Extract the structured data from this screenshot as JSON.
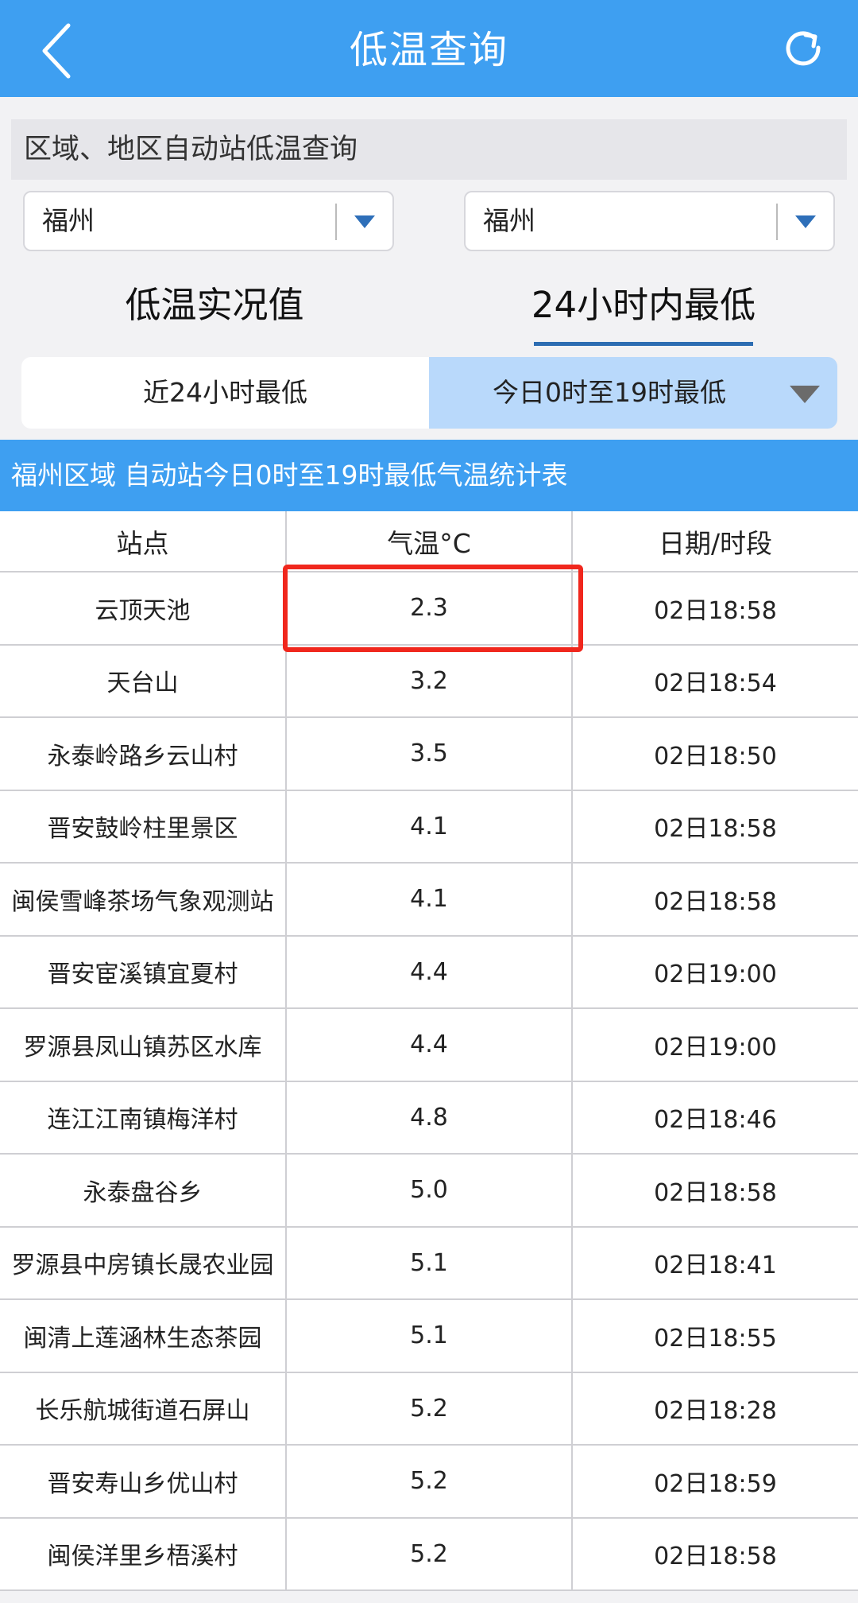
{
  "header": {
    "title": "低温查询",
    "back_icon": "chevron-left-icon",
    "refresh_icon": "refresh-icon"
  },
  "query": {
    "section_label": "区域、地区自动站低温查询",
    "region_select": "福州",
    "area_select": "福州"
  },
  "tabs": {
    "main": [
      "低温实况值",
      "24小时内最低"
    ],
    "active_main": "24小时内最低",
    "sub": [
      "近24小时最低",
      "今日0时至19时最低"
    ],
    "active_sub": "今日0时至19时最低"
  },
  "table": {
    "title": "福州区域 自动站今日0时至19时最低气温统计表",
    "columns": [
      "站点",
      "气温°C",
      "日期/时段"
    ],
    "rows": [
      [
        "云顶天池",
        "2.3",
        "02日18:58"
      ],
      [
        "天台山",
        "3.2",
        "02日18:54"
      ],
      [
        "永泰岭路乡云山村",
        "3.5",
        "02日18:50"
      ],
      [
        "晋安鼓岭柱里景区",
        "4.1",
        "02日18:58"
      ],
      [
        "闽侯雪峰茶场气象观测站",
        "4.1",
        "02日18:58"
      ],
      [
        "晋安宦溪镇宜夏村",
        "4.4",
        "02日19:00"
      ],
      [
        "罗源县凤山镇苏区水库",
        "4.4",
        "02日19:00"
      ],
      [
        "连江江南镇梅洋村",
        "4.8",
        "02日18:46"
      ],
      [
        "永泰盘谷乡",
        "5.0",
        "02日18:58"
      ],
      [
        "罗源县中房镇长晟农业园",
        "5.1",
        "02日18:41"
      ],
      [
        "闽清上莲涵林生态茶园",
        "5.1",
        "02日18:55"
      ],
      [
        "长乐航城街道石屏山",
        "5.2",
        "02日18:28"
      ],
      [
        "晋安寿山乡优山村",
        "5.2",
        "02日18:59"
      ],
      [
        "闽侯洋里乡梧溪村",
        "5.2",
        "02日18:58"
      ]
    ]
  },
  "colors": {
    "accent": "#3e9ff1",
    "highlight": "#f0271d",
    "subtab_active": "#b9d9fb"
  }
}
